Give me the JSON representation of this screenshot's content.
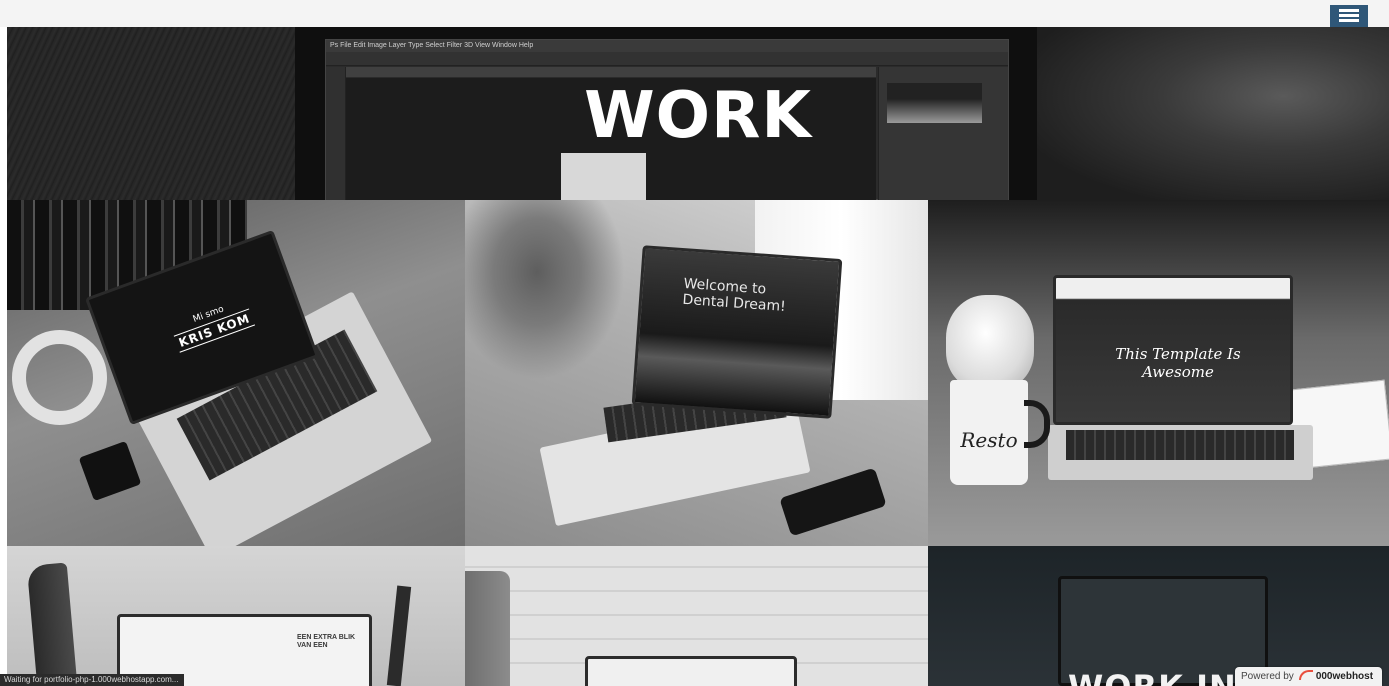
{
  "header": {
    "menu_icon": "hamburger-menu-icon"
  },
  "hero": {
    "title": "WORK",
    "ps_menu": "Ps  File  Edit  Image  Layer  Type  Select  Filter  3D  View  Window  Help"
  },
  "tiles": [
    {
      "screen_small": "Mi smo",
      "screen_big": "KRIS KOM"
    },
    {
      "screen_text": "Welcome to Dental Dream!"
    },
    {
      "screen_text": "This Template Is Awesome",
      "mug_text": "Resto"
    },
    {
      "screen_text": "EEN EXTRA BLIK VAN EEN"
    },
    {},
    {
      "overlay_text": "WORK IN"
    }
  ],
  "status_bar": {
    "text": "Waiting for portfolio-php-1.000webhostapp.com..."
  },
  "hosting_badge": {
    "prefix": "Powered by",
    "brand": "000webhost",
    "logo_icon": "000webhost-logo-icon"
  },
  "colors": {
    "menu_button": "#2f5778",
    "badge_logo": "#e94e3d"
  }
}
